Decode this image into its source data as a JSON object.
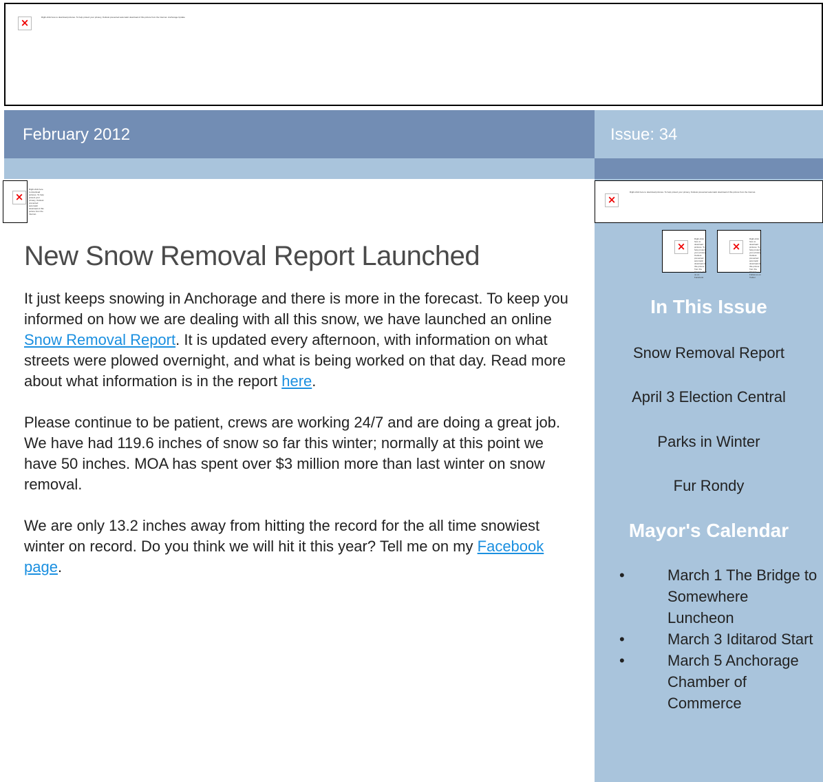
{
  "header_image": {
    "alt_text": "Right-click here to download pictures. To help protect your privacy, Outlook prevented automatic download of this picture from the Internet. Anchorage Update"
  },
  "date_bar": {
    "date": "February 2012",
    "issue": "Issue: 34"
  },
  "main_image": {
    "alt_text": "Right-click here to download pictures. To help protect your privacy, Outlook prevented automatic download of this picture from the Internet."
  },
  "article": {
    "title": "New Snow Removal Report Launched",
    "p1_a": "It just keeps snowing in Anchorage and there is more in the forecast. To keep you informed on how we are dealing with all this snow, we have launched an online ",
    "p1_link": "Snow Removal Report",
    "p1_b": ".   It is updated every afternoon, with information on what streets were plowed overnight, and what is being worked on that day. Read more about what information is in the report ",
    "p1_link2": "here",
    "p1_c": ".",
    "p2": "Please continue to be patient, crews are working 24/7 and are doing a great job. We have had 119.6 inches of snow so far this winter; normally at this point we have 50 inches. MOA has spent over $3 million more than last winter on snow removal.",
    "p3_a": "We are only 13.2 inches away from hitting the record for the all time snowiest winter on record.  Do you think we will hit it this year?  Tell me on my ",
    "p3_link": "Facebook page",
    "p3_b": "."
  },
  "sidebar": {
    "image_alt": "Right-click here to download pictures. To help protect your privacy, Outlook prevented automatic download of this picture from the Internet.",
    "facebook_alt": "Right-click here to download pictures. To help protect your privacy, Outlook prevented automatic download of this picture from the Internet. Find us on Facebook",
    "twitter_alt": "Right-click here to download pictures. To help protect your privacy, Outlook prevented automatic download of this picture from the Internet. Follow us on Twitter",
    "in_this_issue_heading": "In This Issue",
    "issue_items": [
      "Snow Removal Report",
      "April 3 Election Central",
      "Parks in Winter",
      "Fur Rondy"
    ],
    "calendar_heading": "Mayor's Calendar",
    "calendar_bullet": "•",
    "calendar_items": [
      "March 1 The Bridge to Somewhere Luncheon",
      "March 3 Iditarod Start",
      "March 5 Anchorage Chamber of Commerce"
    ]
  },
  "icons": {
    "broken_image": "broken-image-icon",
    "x_glyph": "×"
  },
  "colors": {
    "dark_blue": "#728db4",
    "light_blue": "#a9c4dc",
    "link": "#1a8fe0"
  }
}
